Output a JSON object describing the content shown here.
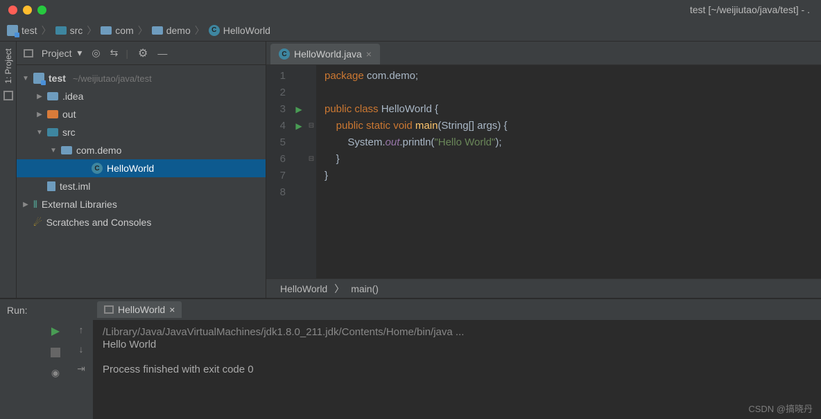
{
  "window": {
    "title": "test [~/weijiutao/java/test] - ."
  },
  "breadcrumb": {
    "items": [
      {
        "label": "test",
        "kind": "module"
      },
      {
        "label": "src",
        "kind": "source"
      },
      {
        "label": "com",
        "kind": "folder"
      },
      {
        "label": "demo",
        "kind": "folder"
      },
      {
        "label": "HelloWorld",
        "kind": "class"
      }
    ]
  },
  "sidebar": {
    "title": "Project",
    "tree": {
      "root": {
        "label": "test",
        "path": "~/weijiutao/java/test"
      },
      "idea": ".idea",
      "out": "out",
      "src": "src",
      "pkg": "com.demo",
      "cls": "HelloWorld",
      "iml": "test.iml",
      "ext": "External Libraries",
      "scratch": "Scratches and Consoles"
    }
  },
  "left_tool": {
    "project": "1: Project"
  },
  "editor": {
    "tab": "HelloWorld.java",
    "lines": [
      "1",
      "2",
      "3",
      "4",
      "5",
      "6",
      "7",
      "8"
    ],
    "code": {
      "l1a": "package",
      "l1b": "com.demo;",
      "l3a": "public class",
      "l3b": "HelloWorld {",
      "l4a": "public static void",
      "l4b": "main",
      "l4c": "(String[] args) {",
      "l5a": "System.",
      "l5b": "out",
      "l5c": ".println(",
      "l5d": "\"Hello World\"",
      "l5e": ");",
      "l6": "}",
      "l7": "}"
    },
    "bottom_bc": {
      "a": "HelloWorld",
      "b": "main()"
    }
  },
  "run": {
    "label": "Run:",
    "tab": "HelloWorld",
    "out_path": "/Library/Java/JavaVirtualMachines/jdk1.8.0_211.jdk/Contents/Home/bin/java ...",
    "out_line": "Hello World",
    "out_exit": "Process finished with exit code 0"
  },
  "watermark": "CSDN @搞晓丹"
}
